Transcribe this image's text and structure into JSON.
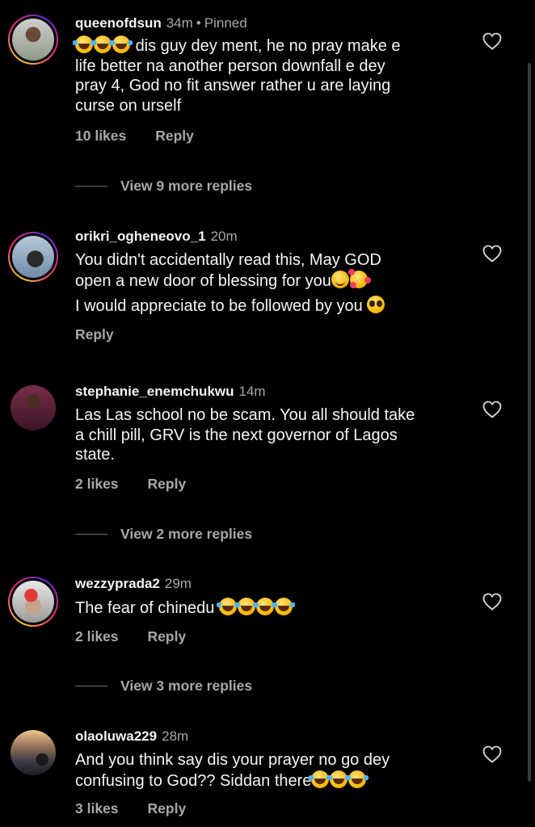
{
  "comments": [
    {
      "username": "queenofdsun",
      "time": "34m",
      "pinned": "Pinned",
      "text_lines": [
        "dis guy dey ment, he no pray make e",
        "life better na another person downfall e dey",
        "pray 4, God no fit answer rather u are laying",
        "curse on urself"
      ],
      "likes": "10 likes",
      "reply": "Reply",
      "view_more": "View 9 more replies"
    },
    {
      "username": "orikri_ogheneovo_1",
      "time": "20m",
      "text_lines": [
        "You didn't accidentally read this, May GOD",
        "open a new door of blessing for you"
      ],
      "text_line2": "I would appreciate to be followed by you",
      "reply": "Reply"
    },
    {
      "username": "stephanie_enemchukwu",
      "time": "14m",
      "text_lines": [
        "Las Las school no be scam. You all should take",
        "a chill pill, GRV is the next governor of Lagos",
        "state."
      ],
      "likes": "2 likes",
      "reply": "Reply",
      "view_more": "View 2 more replies"
    },
    {
      "username": "wezzyprada2",
      "time": "29m",
      "text_lines": [
        "The fear of chinedu"
      ],
      "likes": "2 likes",
      "reply": "Reply",
      "view_more": "View 3 more replies"
    },
    {
      "username": "olaoluwa229",
      "time": "28m",
      "text_lines": [
        "And you think say dis your prayer no go dey",
        "confusing to God?? Siddan there"
      ],
      "likes": "3 likes",
      "reply": "Reply"
    }
  ],
  "icons": {
    "like": "heart-outline-icon",
    "laugh": "face-with-tears-of-joy-emoji",
    "smile": "smiling-face-emoji",
    "blush": "smiling-face-with-hearts-emoji",
    "plead": "pleading-face-emoji"
  },
  "colors": {
    "background": "#000000",
    "primary_text": "#f5f5f5",
    "secondary_text": "#a8a8a8"
  }
}
